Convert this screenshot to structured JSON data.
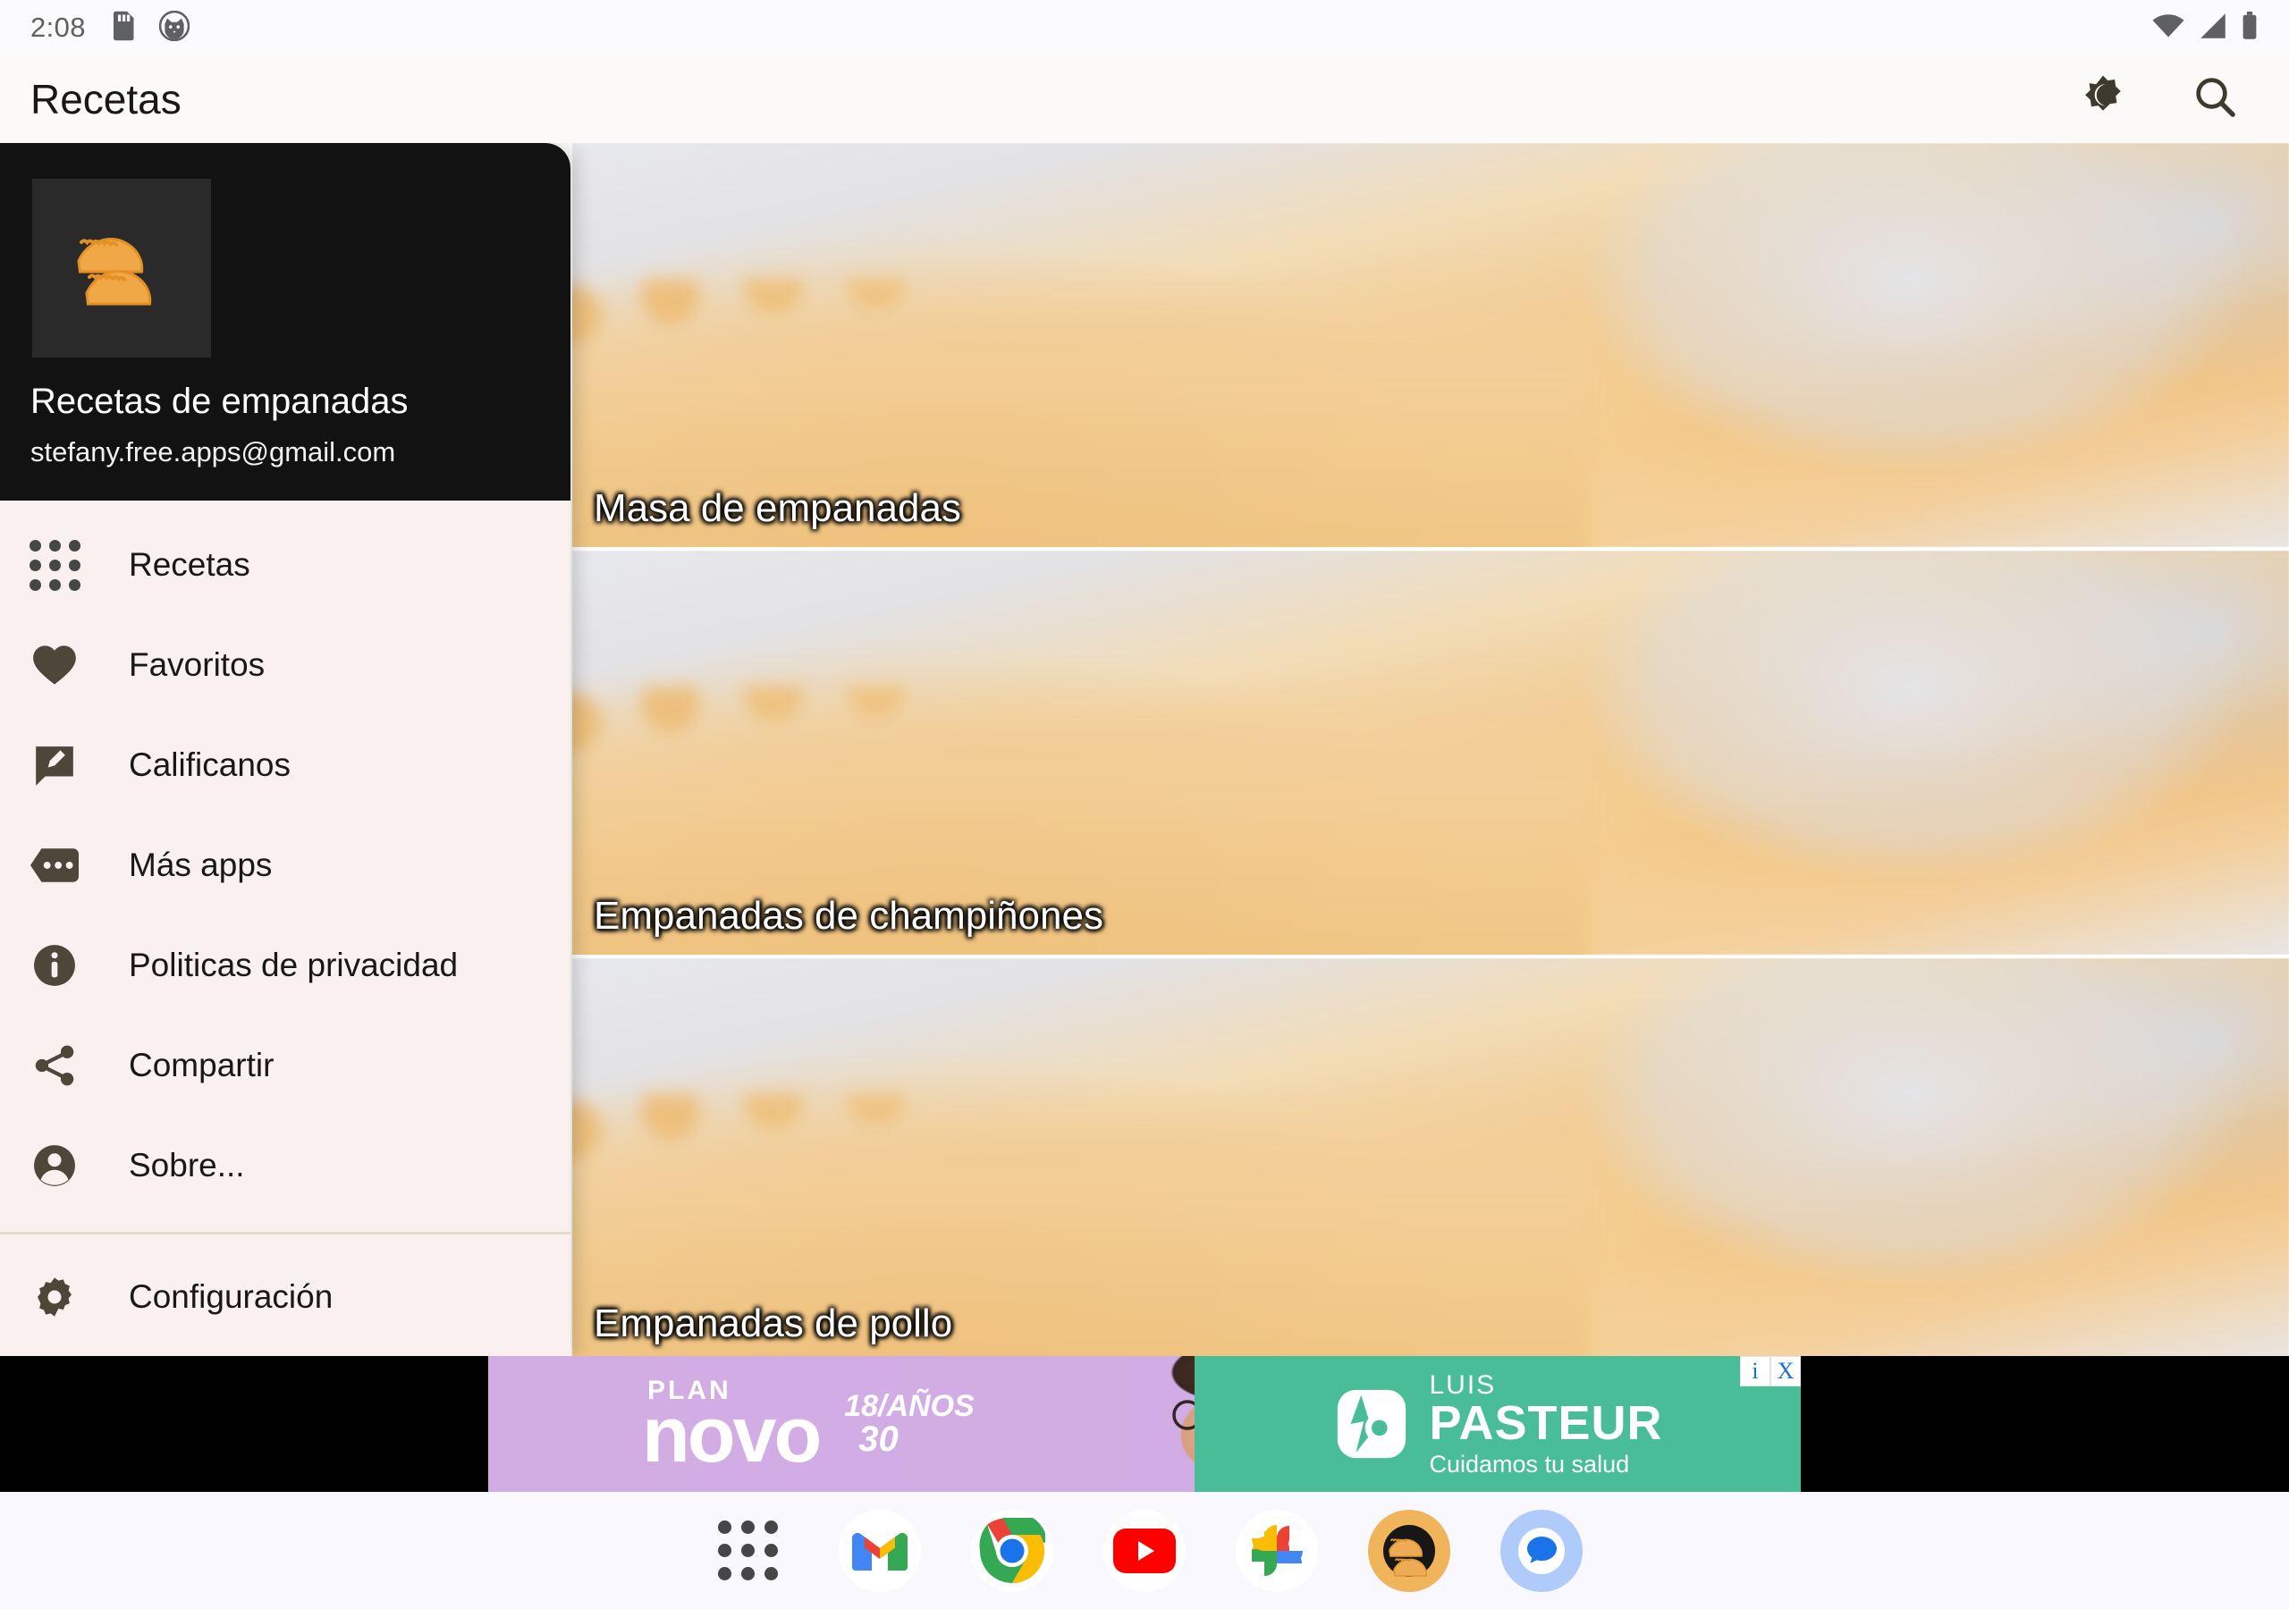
{
  "status_bar": {
    "time": "2:08",
    "icons": [
      "sd-card-icon",
      "cat-face-icon",
      "wifi-icon",
      "cellular-signal-icon",
      "battery-icon"
    ]
  },
  "app_bar": {
    "title": "Recetas",
    "actions": [
      {
        "name": "dark-mode-toggle",
        "icon": "brightness-moon-icon"
      },
      {
        "name": "search-button",
        "icon": "search-icon"
      }
    ]
  },
  "drawer": {
    "account_name": "Recetas de empanadas",
    "account_email": "stefany.free.apps@gmail.com",
    "logo_icon": "empanada-logo-icon",
    "items": [
      {
        "label": "Recetas",
        "icon": "grid-apps-icon"
      },
      {
        "label": "Favoritos",
        "icon": "heart-icon"
      },
      {
        "label": "Calificanos",
        "icon": "rate-review-icon"
      },
      {
        "label": "Más apps",
        "icon": "more-apps-icon"
      },
      {
        "label": "Politicas de privacidad",
        "icon": "info-icon"
      },
      {
        "label": "Compartir",
        "icon": "share-icon"
      },
      {
        "label": "Sobre...",
        "icon": "account-circle-icon"
      }
    ],
    "footer_items": [
      {
        "label": "Configuración",
        "icon": "gear-icon"
      }
    ]
  },
  "recipes": [
    {
      "title": "Masa de empanadas"
    },
    {
      "title": "Empanadas de champiñones"
    },
    {
      "title": "Empanadas de pollo"
    }
  ],
  "ad": {
    "plan_label": "PLAN",
    "brand": "novo",
    "age_top": "18/AÑOS",
    "age_bottom": "30",
    "sponsor_small": "LUIS",
    "sponsor_large": "PASTEUR",
    "sponsor_tagline": "Cuidamos tu salud",
    "info_label": "i",
    "close_label": "X"
  },
  "taskbar": {
    "items": [
      {
        "name": "app-drawer-icon",
        "label": "Apps"
      },
      {
        "name": "gmail-icon",
        "label": "Gmail"
      },
      {
        "name": "chrome-icon",
        "label": "Chrome"
      },
      {
        "name": "youtube-icon",
        "label": "YouTube"
      },
      {
        "name": "google-photos-icon",
        "label": "Photos"
      },
      {
        "name": "recetas-app-icon",
        "label": "Recetas"
      },
      {
        "name": "messages-icon",
        "label": "Messages"
      }
    ]
  },
  "colors": {
    "drawer_bg": "#f9f0ef",
    "drawer_header_bg": "#131212",
    "accent_brown": "#4d4639",
    "ad_purple": "#8622b8",
    "ad_teal": "#49bd98"
  }
}
